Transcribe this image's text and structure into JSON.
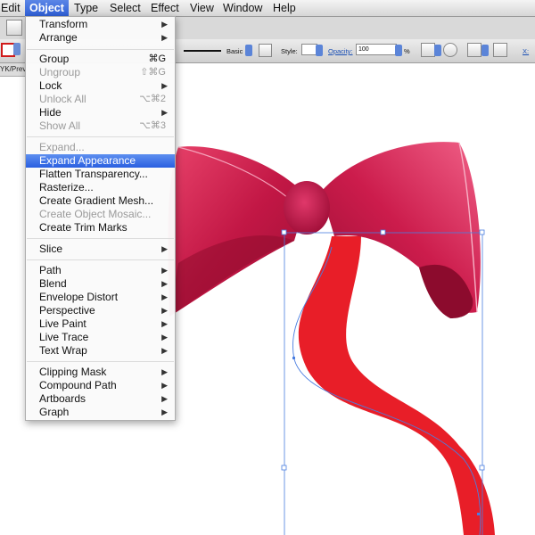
{
  "menubar": {
    "items": [
      "Edit",
      "Object",
      "Type",
      "Select",
      "Effect",
      "View",
      "Window",
      "Help"
    ]
  },
  "control_bar": {
    "stroke_style": "Basic",
    "style_label": "Style:",
    "opacity_label": "Opacity:",
    "opacity_value": "100",
    "opacity_unit": "%",
    "x_label": "X:"
  },
  "doc_tab": "YK/Prev",
  "menu": {
    "items": [
      {
        "label": "Transform",
        "submenu": true,
        "shortcut": ""
      },
      {
        "label": "Arrange",
        "submenu": true,
        "shortcut": ""
      },
      {
        "label": "Group",
        "submenu": false,
        "shortcut": "⌘G"
      },
      {
        "label": "Ungroup",
        "submenu": false,
        "shortcut": "⇧⌘G",
        "disabled": true
      },
      {
        "label": "Lock",
        "submenu": true,
        "shortcut": ""
      },
      {
        "label": "Unlock All",
        "submenu": false,
        "shortcut": "⌥⌘2",
        "disabled": true
      },
      {
        "label": "Hide",
        "submenu": true,
        "shortcut": ""
      },
      {
        "label": "Show All",
        "submenu": false,
        "shortcut": "⌥⌘3",
        "disabled": true
      },
      {
        "label": "Expand...",
        "submenu": false,
        "shortcut": "",
        "disabled": true
      },
      {
        "label": "Expand Appearance",
        "submenu": false,
        "shortcut": "",
        "highlighted": true
      },
      {
        "label": "Flatten Transparency...",
        "submenu": false,
        "shortcut": ""
      },
      {
        "label": "Rasterize...",
        "submenu": false,
        "shortcut": ""
      },
      {
        "label": "Create Gradient Mesh...",
        "submenu": false,
        "shortcut": ""
      },
      {
        "label": "Create Object Mosaic...",
        "submenu": false,
        "shortcut": "",
        "disabled": true
      },
      {
        "label": "Create Trim Marks",
        "submenu": false,
        "shortcut": ""
      },
      {
        "label": "Slice",
        "submenu": true,
        "shortcut": ""
      },
      {
        "label": "Path",
        "submenu": true,
        "shortcut": ""
      },
      {
        "label": "Blend",
        "submenu": true,
        "shortcut": ""
      },
      {
        "label": "Envelope Distort",
        "submenu": true,
        "shortcut": ""
      },
      {
        "label": "Perspective",
        "submenu": true,
        "shortcut": ""
      },
      {
        "label": "Live Paint",
        "submenu": true,
        "shortcut": ""
      },
      {
        "label": "Live Trace",
        "submenu": true,
        "shortcut": ""
      },
      {
        "label": "Text Wrap",
        "submenu": true,
        "shortcut": ""
      },
      {
        "label": "Clipping Mask",
        "submenu": true,
        "shortcut": ""
      },
      {
        "label": "Compound Path",
        "submenu": true,
        "shortcut": ""
      },
      {
        "label": "Artboards",
        "submenu": true,
        "shortcut": ""
      },
      {
        "label": "Graph",
        "submenu": true,
        "shortcut": ""
      }
    ]
  },
  "colors": {
    "menubar_highlight": "#2f5fd6",
    "ribbon_red": "#e81e28",
    "bow_dark": "#b8123c",
    "bow_light": "#e8426a",
    "selection_blue": "#4a7ee0"
  }
}
